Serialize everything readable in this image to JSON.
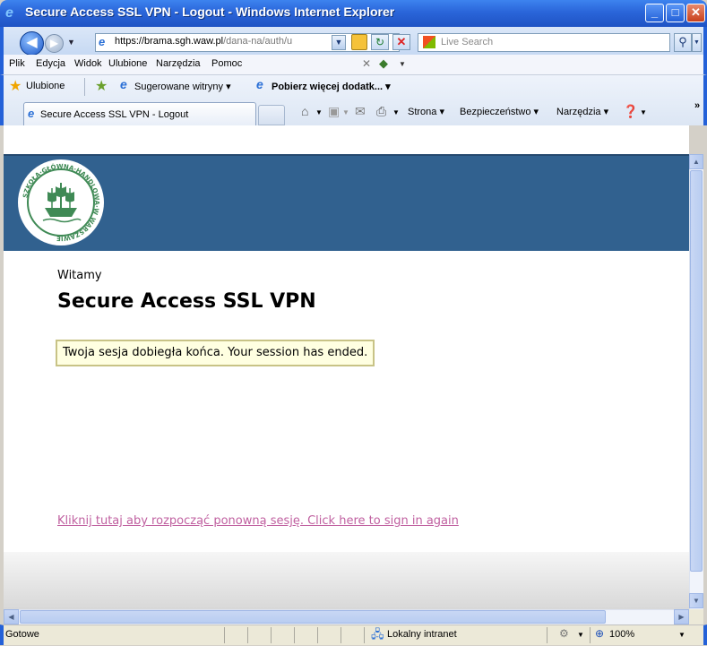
{
  "window": {
    "title": "Secure Access SSL VPN - Logout - Windows Internet Explorer",
    "minimize": "_",
    "maximize": "□",
    "close": "✕"
  },
  "address": {
    "url_host": "https://brama.sgh.waw.pl",
    "url_path": "/dana-na/auth/u",
    "search_placeholder": "Live Search"
  },
  "menu": {
    "items": [
      "Plik",
      "Edycja",
      "Widok",
      "Ulubione",
      "Narzędzia",
      "Pomoc"
    ]
  },
  "favorites": {
    "label": "Ulubione",
    "suggested": "Sugerowane witryny ▾",
    "more_addons": "Pobierz więcej dodatk... ▾"
  },
  "tab": {
    "label": "Secure Access SSL VPN - Logout"
  },
  "commands": {
    "page": "Strona ▾",
    "safety": "Bezpieczeństwo ▾",
    "tools": "Narzędzia ▾",
    "chevron": "»"
  },
  "page": {
    "welcome": "Witamy",
    "heading": "Secure Access SSL VPN",
    "message": "Twoja sesja dobiegła końca. Your session has ended.",
    "signin_link": "Kliknij tutaj aby rozpocząć ponowną sesję. Click here to sign in again",
    "logo_text": "SZKOŁA GŁÓWNA HANDLOWA W WARSZAWIE"
  },
  "status": {
    "text": "Gotowe",
    "zone": "Lokalny intranet",
    "zoom": "100%"
  },
  "colors": {
    "banner": "#31618f",
    "message_bg": "#ffffe1",
    "link": "#c060a0"
  }
}
